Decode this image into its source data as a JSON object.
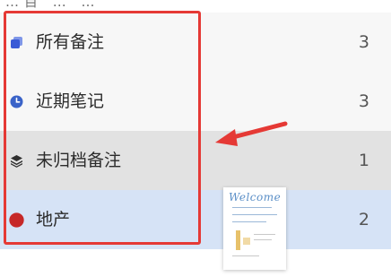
{
  "header_fragment": "…目  …  …",
  "folders": [
    {
      "label": "所有备注",
      "count": "3",
      "icon": "notes-stack-icon",
      "icon_color": "#3a5bd6"
    },
    {
      "label": "近期笔记",
      "count": "3",
      "icon": "clock-icon",
      "icon_color": "#3a63c8"
    },
    {
      "label": "未归档备注",
      "count": "1",
      "icon": "layers-icon",
      "icon_color": "#2f2f2f"
    },
    {
      "label": "地产",
      "count": "2",
      "icon": "red-dot-icon",
      "icon_color": "#c62828"
    }
  ],
  "annotation": {
    "box_color": "#e53935",
    "arrow_color": "#e53935"
  },
  "thumbnail": {
    "title": "Welcome"
  },
  "colors": {
    "row_bg": "#f7f7f7",
    "row_hover_bg": "#e2e2e2",
    "row_selected_bg": "#d6e3f6"
  }
}
